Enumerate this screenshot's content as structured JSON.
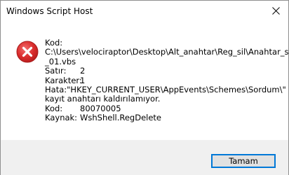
{
  "window": {
    "title": "Windows Script Host"
  },
  "icons": {
    "error": "error-icon",
    "close": "close-icon",
    "error_color": "#d92b2b"
  },
  "message": {
    "kod_label": "Kod:",
    "path_line1": "C:\\Users\\velociraptor\\Desktop\\Alt_anahtar\\Reg_sil\\Anahtar_sil",
    "path_line2": "_01.vbs",
    "satir_label": "Satır:",
    "satir_value": "2",
    "karakter_label": "Karakter:",
    "karakter_value": "1",
    "hata_label": "Hata:",
    "hata_value": "\"HKEY_CURRENT_USER\\AppEvents\\Schemes\\Sordum\\\"",
    "hata_line2": "kayıt anahtarı kaldırılamıyor.",
    "kod2_label": "Kod:",
    "kod2_value": "80070005",
    "kaynak_label": "Kaynak:",
    "kaynak_value": "WshShell.RegDelete"
  },
  "footer": {
    "ok_label": "Tamam"
  }
}
